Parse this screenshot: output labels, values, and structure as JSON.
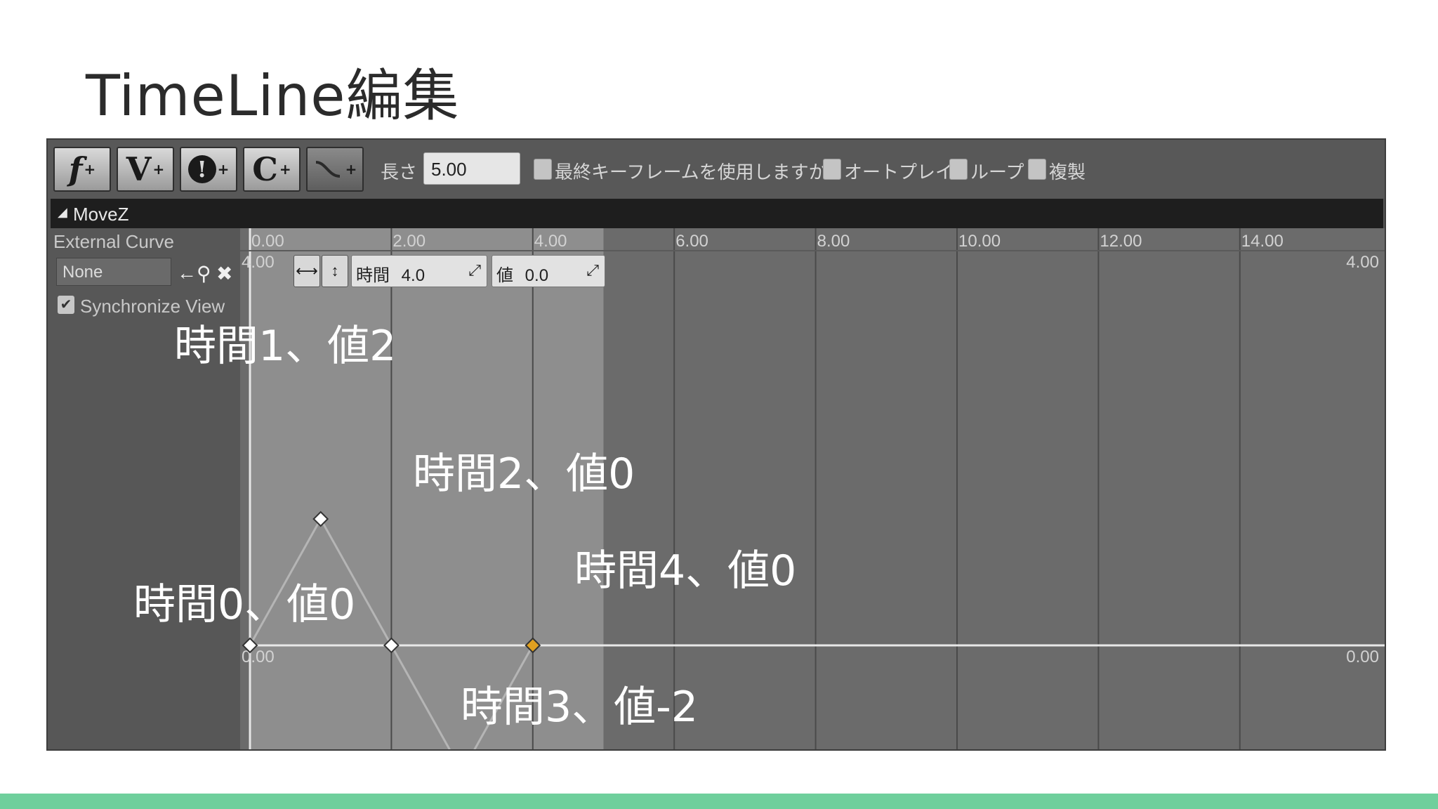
{
  "slide": {
    "title": "TimeLine編集"
  },
  "toolbar": {
    "buttons": [
      {
        "id": "float",
        "label": "f",
        "sup": "+"
      },
      {
        "id": "vector",
        "label": "V",
        "sup": "+"
      },
      {
        "id": "event",
        "label": "!",
        "sup": "+"
      },
      {
        "id": "color",
        "label": "C",
        "sup": "+"
      },
      {
        "id": "external-curve",
        "label": "",
        "sup": "+"
      }
    ],
    "length_label": "長さ",
    "length_value": "5.00",
    "use_last_keyframe_label": "最終キーフレームを使用しますか？",
    "autoplay_label": "オートプレイ",
    "loop_label": "ループ",
    "replicate_label": "複製"
  },
  "track": {
    "name": "MoveZ",
    "collapse_icon": "triangle-down-icon"
  },
  "left_panel": {
    "external_curve_label": "External Curve",
    "external_curve_value": "None",
    "icons": [
      "arrow-left-icon",
      "search-icon",
      "close-icon"
    ],
    "sync_view_label": "Synchronize View",
    "sync_view_checked": true
  },
  "graph": {
    "time_ticks": [
      "0.00",
      "2.00",
      "4.00",
      "6.00",
      "8.00",
      "10.00",
      "12.00",
      "14.00"
    ],
    "value_max_label": "4.00",
    "value_zero_label": "0.00",
    "selected_key": {
      "time_label": "時間",
      "time_value": "4.0",
      "value_label": "値",
      "value_value": "0.0"
    },
    "colors": {
      "active_range": "#8e8e8e",
      "inactive": "#6b6b6b",
      "selected_key": "#e0a020"
    }
  },
  "chart_data": {
    "type": "line",
    "x": [
      0,
      1,
      2,
      3,
      4
    ],
    "series": [
      {
        "values": [
          0,
          2,
          0,
          -2,
          0
        ]
      }
    ],
    "xlim": [
      0,
      16
    ],
    "ylim": [
      -4,
      4
    ],
    "active_length": 5.0,
    "selected_index": 4
  },
  "annotations": [
    "時間1、値2",
    "時間2、値0",
    "時間4、値0",
    "時間0、値0",
    "時間3、値-2"
  ]
}
